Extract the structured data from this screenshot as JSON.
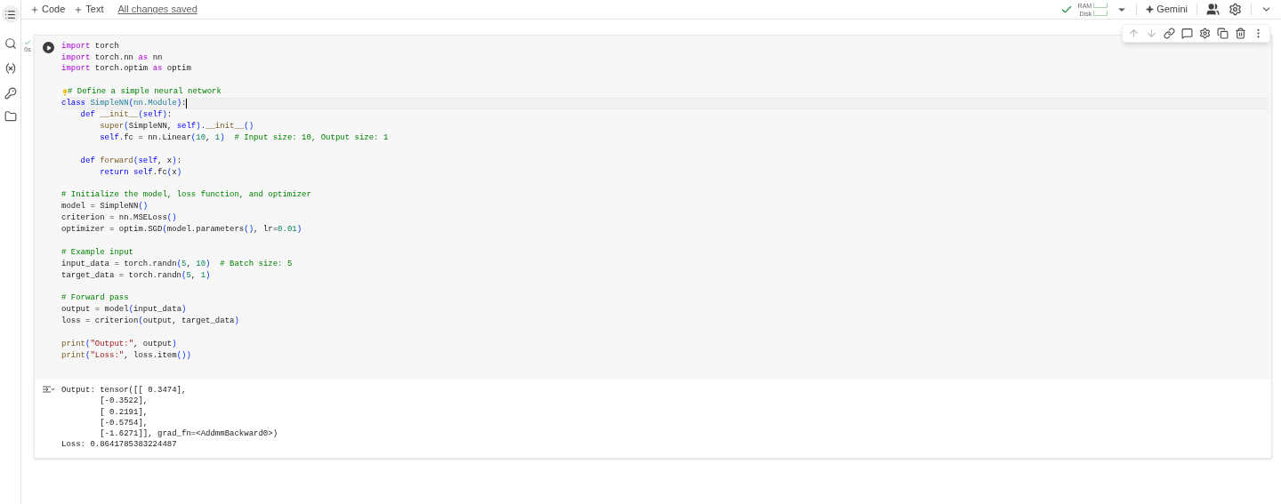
{
  "toolbar": {
    "add_code": "Code",
    "add_text": "Text",
    "save_status": "All changes saved",
    "ram_label": "RAM",
    "disk_label": "Disk",
    "gemini": "Gemini"
  },
  "cell": {
    "exec_time": "0s",
    "executed": true,
    "lines": [
      {
        "kind": "code",
        "tokens": [
          {
            "kind": "kw",
            "text": "import"
          },
          {
            "kind": "pl",
            "text": " torch"
          }
        ]
      },
      {
        "kind": "code",
        "tokens": [
          {
            "kind": "kw",
            "text": "import"
          },
          {
            "kind": "pl",
            "text": " torch.nn "
          },
          {
            "kind": "kw",
            "text": "as"
          },
          {
            "kind": "pl",
            "text": " nn"
          }
        ]
      },
      {
        "kind": "code",
        "tokens": [
          {
            "kind": "kw",
            "text": "import"
          },
          {
            "kind": "pl",
            "text": " torch.optim "
          },
          {
            "kind": "kw",
            "text": "as"
          },
          {
            "kind": "pl",
            "text": " optim"
          }
        ]
      },
      {
        "kind": "blank"
      },
      {
        "kind": "code",
        "hint": true,
        "tokens": [
          {
            "kind": "cm",
            "text": "# Define a simple neural network"
          }
        ]
      },
      {
        "kind": "code",
        "current": true,
        "tokens": [
          {
            "kind": "def",
            "text": "class "
          },
          {
            "kind": "cls",
            "text": "SimpleNN"
          },
          {
            "kind": "br",
            "text": "("
          },
          {
            "kind": "cls",
            "text": "nn.Module"
          },
          {
            "kind": "br",
            "text": ")"
          },
          {
            "kind": "pl",
            "text": ":"
          }
        ]
      },
      {
        "kind": "code",
        "tokens": [
          {
            "kind": "def",
            "text": "    def "
          },
          {
            "kind": "fn",
            "text": "__init__"
          },
          {
            "kind": "br",
            "text": "("
          },
          {
            "kind": "def",
            "text": "self"
          },
          {
            "kind": "br",
            "text": ")"
          },
          {
            "kind": "pl",
            "text": ":"
          }
        ]
      },
      {
        "kind": "code",
        "tokens": [
          {
            "kind": "fn",
            "text": "        super"
          },
          {
            "kind": "br",
            "text": "("
          },
          {
            "kind": "pl",
            "text": "SimpleNN, "
          },
          {
            "kind": "def",
            "text": "self"
          },
          {
            "kind": "br",
            "text": ")"
          },
          {
            "kind": "pl",
            "text": "."
          },
          {
            "kind": "fn",
            "text": "__init__"
          },
          {
            "kind": "br",
            "text": "()"
          }
        ]
      },
      {
        "kind": "code",
        "tokens": [
          {
            "kind": "def",
            "text": "        self"
          },
          {
            "kind": "pl",
            "text": ".fc = nn.Linear"
          },
          {
            "kind": "br",
            "text": "("
          },
          {
            "kind": "num",
            "text": "10"
          },
          {
            "kind": "pl",
            "text": ", "
          },
          {
            "kind": "num",
            "text": "1"
          },
          {
            "kind": "br",
            "text": ")"
          },
          {
            "kind": "cm",
            "text": "  # Input size: 10, Output size: 1"
          }
        ]
      },
      {
        "kind": "blank"
      },
      {
        "kind": "code",
        "tokens": [
          {
            "kind": "def",
            "text": "    def "
          },
          {
            "kind": "fn",
            "text": "forward"
          },
          {
            "kind": "br",
            "text": "("
          },
          {
            "kind": "def",
            "text": "self"
          },
          {
            "kind": "pl",
            "text": ", x"
          },
          {
            "kind": "br",
            "text": ")"
          },
          {
            "kind": "pl",
            "text": ":"
          }
        ]
      },
      {
        "kind": "code",
        "tokens": [
          {
            "kind": "def",
            "text": "        return self"
          },
          {
            "kind": "pl",
            "text": ".fc"
          },
          {
            "kind": "br",
            "text": "("
          },
          {
            "kind": "pl",
            "text": "x"
          },
          {
            "kind": "br",
            "text": ")"
          }
        ]
      },
      {
        "kind": "blank"
      },
      {
        "kind": "code",
        "tokens": [
          {
            "kind": "cm",
            "text": "# Initialize the model, loss function, and optimizer"
          }
        ]
      },
      {
        "kind": "code",
        "tokens": [
          {
            "kind": "pl",
            "text": "model = SimpleNN"
          },
          {
            "kind": "br",
            "text": "()"
          }
        ]
      },
      {
        "kind": "code",
        "tokens": [
          {
            "kind": "pl",
            "text": "criterion = nn.MSELoss"
          },
          {
            "kind": "br",
            "text": "()"
          }
        ]
      },
      {
        "kind": "code",
        "tokens": [
          {
            "kind": "pl",
            "text": "optimizer = optim.SGD"
          },
          {
            "kind": "br",
            "text": "("
          },
          {
            "kind": "pl",
            "text": "model.parameters"
          },
          {
            "kind": "br",
            "text": "()"
          },
          {
            "kind": "pl",
            "text": ", lr="
          },
          {
            "kind": "num",
            "text": "0.01"
          },
          {
            "kind": "br",
            "text": ")"
          }
        ]
      },
      {
        "kind": "blank"
      },
      {
        "kind": "code",
        "tokens": [
          {
            "kind": "cm",
            "text": "# Example input"
          }
        ]
      },
      {
        "kind": "code",
        "tokens": [
          {
            "kind": "pl",
            "text": "input_data = torch.randn"
          },
          {
            "kind": "br",
            "text": "("
          },
          {
            "kind": "num",
            "text": "5"
          },
          {
            "kind": "pl",
            "text": ", "
          },
          {
            "kind": "num",
            "text": "10"
          },
          {
            "kind": "br",
            "text": ")"
          },
          {
            "kind": "cm",
            "text": "  # Batch size: 5"
          }
        ]
      },
      {
        "kind": "code",
        "tokens": [
          {
            "kind": "pl",
            "text": "target_data = torch.randn"
          },
          {
            "kind": "br",
            "text": "("
          },
          {
            "kind": "num",
            "text": "5"
          },
          {
            "kind": "pl",
            "text": ", "
          },
          {
            "kind": "num",
            "text": "1"
          },
          {
            "kind": "br",
            "text": ")"
          }
        ]
      },
      {
        "kind": "blank"
      },
      {
        "kind": "code",
        "tokens": [
          {
            "kind": "cm",
            "text": "# Forward pass"
          }
        ]
      },
      {
        "kind": "code",
        "tokens": [
          {
            "kind": "pl",
            "text": "output = model"
          },
          {
            "kind": "br",
            "text": "("
          },
          {
            "kind": "pl",
            "text": "input_data"
          },
          {
            "kind": "br",
            "text": ")"
          }
        ]
      },
      {
        "kind": "code",
        "tokens": [
          {
            "kind": "pl",
            "text": "loss = criterion"
          },
          {
            "kind": "br",
            "text": "("
          },
          {
            "kind": "pl",
            "text": "output, target_data"
          },
          {
            "kind": "br",
            "text": ")"
          }
        ]
      },
      {
        "kind": "blank"
      },
      {
        "kind": "code",
        "tokens": [
          {
            "kind": "fn",
            "text": "print"
          },
          {
            "kind": "br",
            "text": "("
          },
          {
            "kind": "str",
            "text": "\"Output:\""
          },
          {
            "kind": "pl",
            "text": ", output"
          },
          {
            "kind": "br",
            "text": ")"
          }
        ]
      },
      {
        "kind": "code",
        "tokens": [
          {
            "kind": "fn",
            "text": "print"
          },
          {
            "kind": "br",
            "text": "("
          },
          {
            "kind": "str",
            "text": "\"Loss:\""
          },
          {
            "kind": "pl",
            "text": ", loss.item"
          },
          {
            "kind": "br",
            "text": "()"
          },
          {
            "kind": "br",
            "text": ")"
          }
        ]
      }
    ],
    "output": [
      "Output: tensor([[ 0.3474],",
      "        [-0.3522],",
      "        [ 0.2191],",
      "        [-0.5754],",
      "        [-1.6271]], grad_fn=<AddmmBackward0>)",
      "Loss: 0.8641785383224487"
    ]
  }
}
